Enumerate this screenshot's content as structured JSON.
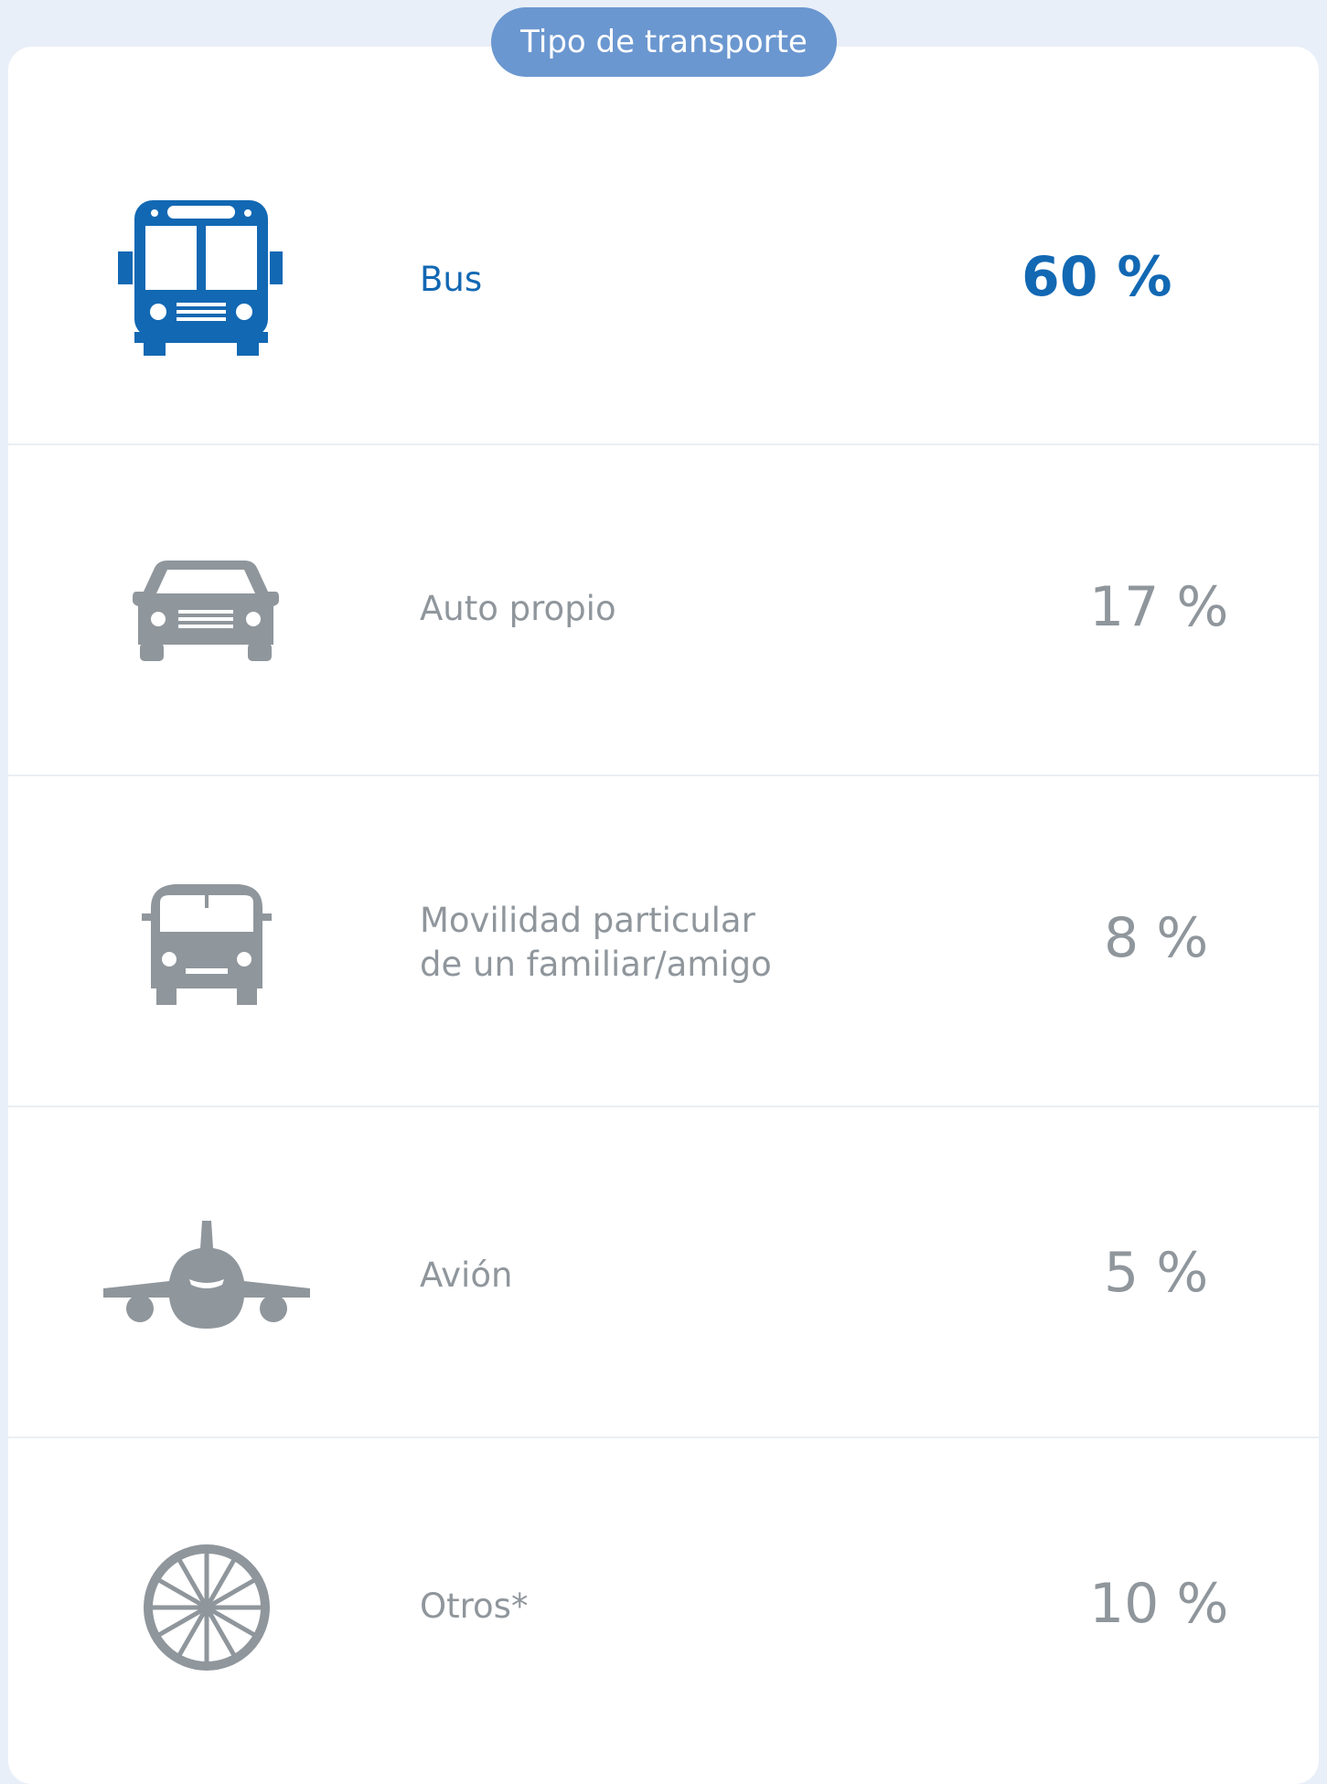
{
  "header": {
    "title": "Tipo de transporte"
  },
  "colors": {
    "highlight": "#1268b3",
    "muted": "#8f969c",
    "pill": "#6b97d0"
  },
  "chart_data": {
    "type": "table",
    "title": "Tipo de transporte",
    "categories": [
      "Bus",
      "Auto propio",
      "Movilidad particular de un familiar/amigo",
      "Avión",
      "Otros*"
    ],
    "values": [
      60,
      17,
      8,
      5,
      10
    ],
    "unit": "%",
    "rows": [
      {
        "label": "Bus",
        "value": "60 %",
        "icon": "bus-icon",
        "highlight": true
      },
      {
        "label": "Auto propio",
        "value": "17 %",
        "icon": "car-icon",
        "highlight": false
      },
      {
        "label_line1": "Movilidad particular",
        "label_line2": "de un familiar/amigo",
        "value": "8 %",
        "icon": "van-icon",
        "highlight": false
      },
      {
        "label": "Avión",
        "value": "5 %",
        "icon": "airplane-icon",
        "highlight": false
      },
      {
        "label": "Otros*",
        "value": "10 %",
        "icon": "wheel-icon",
        "highlight": false
      }
    ]
  }
}
